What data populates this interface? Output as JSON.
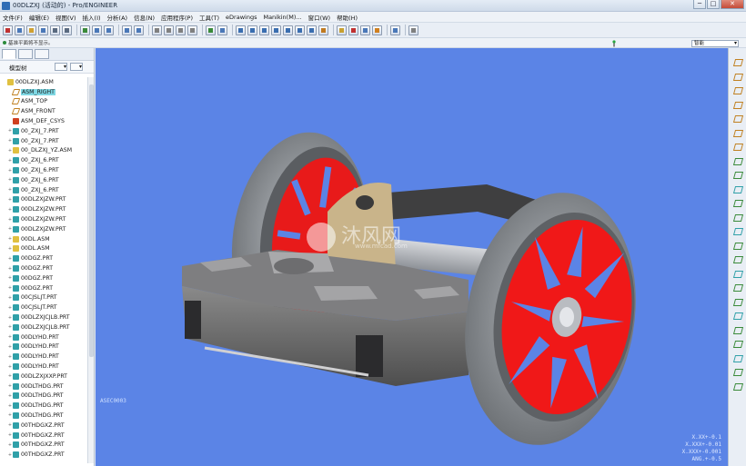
{
  "window": {
    "title": "00DLZXJ (活动的) - Pro/ENGINEER",
    "buttons": [
      "─",
      "□",
      "✕"
    ]
  },
  "menubar": {
    "items": [
      "文件(F)",
      "编辑(E)",
      "视图(V)",
      "插入(I)",
      "分析(A)",
      "信息(N)",
      "应用程序(P)",
      "工具(T)",
      "eDrawings",
      "Manikin(M)...",
      "窗口(W)",
      "帮助(H)"
    ]
  },
  "status": {
    "message": "基准平面将不显示。"
  },
  "filter": {
    "value": "智能"
  },
  "model_tree": {
    "header": "模型树",
    "items": [
      {
        "label": "00DLZXJ.ASM",
        "type": "asm",
        "level": 0,
        "expander": ""
      },
      {
        "label": "ASM_RIGHT",
        "type": "plane",
        "level": 1,
        "expander": "",
        "selected": true
      },
      {
        "label": "ASM_TOP",
        "type": "plane",
        "level": 1,
        "expander": ""
      },
      {
        "label": "ASM_FRONT",
        "type": "plane",
        "level": 1,
        "expander": ""
      },
      {
        "label": "ASM_DEF_CSYS",
        "type": "csys",
        "level": 1,
        "expander": ""
      },
      {
        "label": "00_ZXJ_7.PRT",
        "type": "prt",
        "level": 1,
        "expander": "+"
      },
      {
        "label": "00_ZXJ_7.PRT",
        "type": "prt",
        "level": 1,
        "expander": "+"
      },
      {
        "label": "00_DLZXJ_YZ.ASM",
        "type": "asm",
        "level": 1,
        "expander": "+"
      },
      {
        "label": "00_ZXJ_6.PRT",
        "type": "prt",
        "level": 1,
        "expander": "+"
      },
      {
        "label": "00_ZXJ_6.PRT",
        "type": "prt",
        "level": 1,
        "expander": "+"
      },
      {
        "label": "00_ZXJ_6.PRT",
        "type": "prt",
        "level": 1,
        "expander": "+"
      },
      {
        "label": "00_ZXJ_6.PRT",
        "type": "prt",
        "level": 1,
        "expander": "+"
      },
      {
        "label": "00DLZXJZW.PRT",
        "type": "prt",
        "level": 1,
        "expander": "+"
      },
      {
        "label": "00DLZXJZW.PRT",
        "type": "prt",
        "level": 1,
        "expander": "+"
      },
      {
        "label": "00DLZXJZW.PRT",
        "type": "prt",
        "level": 1,
        "expander": "+"
      },
      {
        "label": "00DLZXJZW.PRT",
        "type": "prt",
        "level": 1,
        "expander": "+"
      },
      {
        "label": "00DL.ASM",
        "type": "asm",
        "level": 1,
        "expander": "+"
      },
      {
        "label": "00DL.ASM",
        "type": "asm",
        "level": 1,
        "expander": "+"
      },
      {
        "label": "00DGZ.PRT",
        "type": "prt",
        "level": 1,
        "expander": "+"
      },
      {
        "label": "00DGZ.PRT",
        "type": "prt",
        "level": 1,
        "expander": "+"
      },
      {
        "label": "00DGZ.PRT",
        "type": "prt",
        "level": 1,
        "expander": "+"
      },
      {
        "label": "00DGZ.PRT",
        "type": "prt",
        "level": 1,
        "expander": "+"
      },
      {
        "label": "00CJSLJT.PRT",
        "type": "prt",
        "level": 1,
        "expander": "+"
      },
      {
        "label": "00CJSLJT.PRT",
        "type": "prt",
        "level": 1,
        "expander": "+"
      },
      {
        "label": "00DLZXJCJLB.PRT",
        "type": "prt",
        "level": 1,
        "expander": "+"
      },
      {
        "label": "00DLZXJCJLB.PRT",
        "type": "prt",
        "level": 1,
        "expander": "+"
      },
      {
        "label": "00DLYHD.PRT",
        "type": "prt",
        "level": 1,
        "expander": "+"
      },
      {
        "label": "00DLYHD.PRT",
        "type": "prt",
        "level": 1,
        "expander": "+"
      },
      {
        "label": "00DLYHD.PRT",
        "type": "prt",
        "level": 1,
        "expander": "+"
      },
      {
        "label": "00DLYHD.PRT",
        "type": "prt",
        "level": 1,
        "expander": "+"
      },
      {
        "label": "00DLZXJXXP.PRT",
        "type": "prt",
        "level": 1,
        "expander": "+"
      },
      {
        "label": "00DLTHDG.PRT",
        "type": "prt",
        "level": 1,
        "expander": "+"
      },
      {
        "label": "00DLTHDG.PRT",
        "type": "prt",
        "level": 1,
        "expander": "+"
      },
      {
        "label": "00DLTHDG.PRT",
        "type": "prt",
        "level": 1,
        "expander": "+"
      },
      {
        "label": "00DLTHDG.PRT",
        "type": "prt",
        "level": 1,
        "expander": "+"
      },
      {
        "label": "00THDGXZ.PRT",
        "type": "prt",
        "level": 1,
        "expander": "+"
      },
      {
        "label": "00THDGXZ.PRT",
        "type": "prt",
        "level": 1,
        "expander": "+"
      },
      {
        "label": "00THDGXZ.PRT",
        "type": "prt",
        "level": 1,
        "expander": "+"
      },
      {
        "label": "00THDGXZ.PRT",
        "type": "prt",
        "level": 1,
        "expander": "+"
      }
    ]
  },
  "viewport": {
    "background_color": "#5b84e6",
    "watermark_text": "沐风网",
    "watermark_url": "www.mfcad.com",
    "view_label": "ASEC0003",
    "readout": [
      "X.XX+-0.1",
      "X.XXX+-0.01",
      "X.XXX+-0.001",
      "ANG.+-0.5"
    ]
  },
  "colors": {
    "wheel_spoke": "#f01818",
    "wheel_rim": "#8e9296",
    "frame": "#6b6b6b",
    "bearing_block": "#c9b48a"
  }
}
